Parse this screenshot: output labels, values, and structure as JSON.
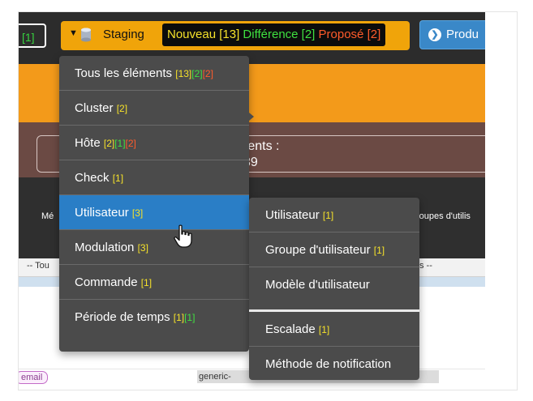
{
  "topbar": {
    "prev_count": "[1]",
    "staging": {
      "label": "Staging",
      "nouveau": "Nouveau [13]",
      "difference": "Différence [2]",
      "propose": "Proposé [2]"
    },
    "produ_label": "Produ"
  },
  "page": {
    "counter_label": "ments :",
    "counter_value": "39",
    "col_left": "Mé",
    "col_right": "roupes d'utilis",
    "filter_left": "-- Tou",
    "filter_right": "s --",
    "email_tag": "email",
    "generic_tag": "generic-"
  },
  "menu": {
    "items": [
      {
        "label": "Tous les éléments",
        "a": "[13]",
        "b": "[2]",
        "c": "[2]"
      },
      {
        "label": "Cluster",
        "a": "[2]"
      },
      {
        "label": "Hôte",
        "a": "[2]",
        "b": "[1]",
        "c": "[2]"
      },
      {
        "label": "Check",
        "a": "[1]"
      },
      {
        "label": "Utilisateur",
        "a": "[3]"
      },
      {
        "label": "Modulation",
        "a": "[3]"
      },
      {
        "label": "Commande",
        "a": "[1]"
      },
      {
        "label": "Période de temps",
        "a": "[1]",
        "b": "[1]"
      }
    ]
  },
  "submenu": {
    "items": [
      {
        "label": "Utilisateur",
        "a": "[1]"
      },
      {
        "label": "Groupe d'utilisateur",
        "a": "[1]"
      },
      {
        "label": "Modèle d'utilisateur"
      },
      {
        "label": "Escalade",
        "a": "[1]"
      },
      {
        "label": "Méthode de notification"
      }
    ]
  },
  "colors": {
    "staging_bg": "#f0a40a",
    "menu_bg": "#4b4b4b",
    "active_item": "#2a7ec6",
    "count_yellow": "#f5e12a",
    "count_green": "#3fe040",
    "count_red": "#ff5b2b"
  },
  "icons": [
    "caret-down-icon",
    "database-icon",
    "circle-arrow-right-icon",
    "hand-pointer-icon",
    "submenu-arrow-icon"
  ]
}
